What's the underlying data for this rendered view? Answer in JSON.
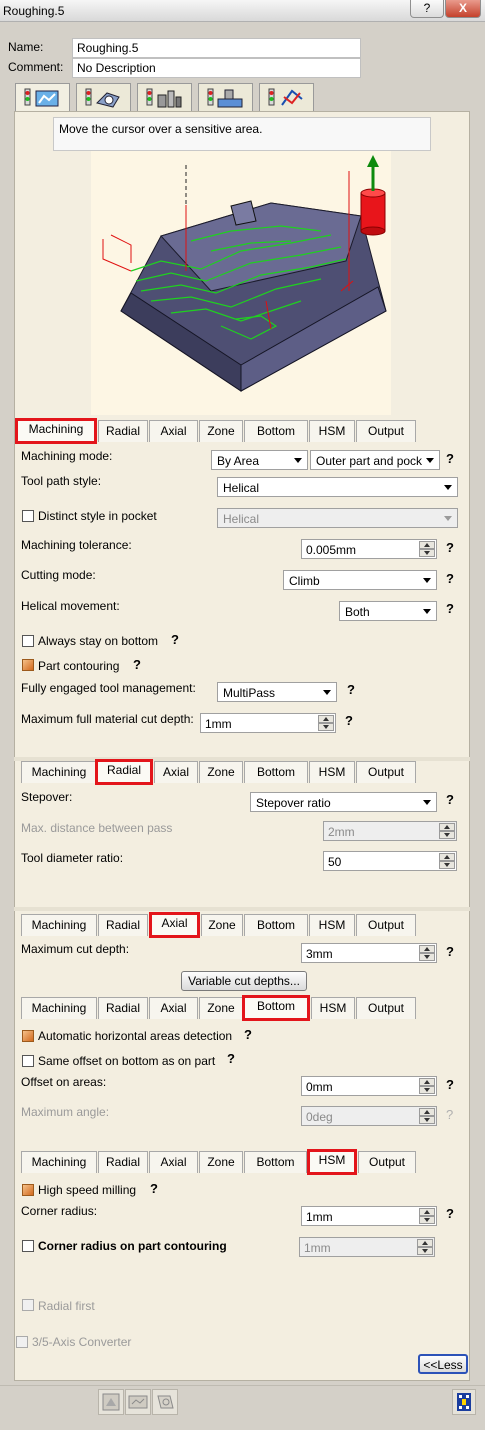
{
  "window": {
    "title": "Roughing.5",
    "help_btn": "?",
    "close_btn": "X"
  },
  "header": {
    "name_label": "Name:",
    "name_value": "Roughing.5",
    "comment_label": "Comment:",
    "comment_value": "No Description"
  },
  "icon_tabs": [
    "strategy-icon",
    "geometry-icon",
    "tool-icon",
    "feeds-speeds-icon",
    "macros-icon"
  ],
  "info": {
    "message": "Move the cursor over a sensitive area."
  },
  "tabs": [
    "Machining",
    "Radial",
    "Axial",
    "Zone",
    "Bottom",
    "HSM",
    "Output"
  ],
  "machining": {
    "mode_label": "Machining mode:",
    "mode_value": "By Area",
    "mode_value2": "Outer part and pock",
    "toolpath_label": "Tool path style:",
    "toolpath_value": "Helical",
    "distinct_label": "Distinct style in pocket",
    "distinct_value": "Helical",
    "tolerance_label": "Machining tolerance:",
    "tolerance_value": "0.005mm",
    "cutting_label": "Cutting mode:",
    "cutting_value": "Climb",
    "helical_label": "Helical movement:",
    "helical_value": "Both",
    "always_bottom_label": "Always stay on bottom",
    "part_contouring_label": "Part contouring",
    "engaged_label": "Fully engaged tool management:",
    "engaged_value": "MultiPass",
    "max_cut_label": "Maximum full material cut depth:",
    "max_cut_value": "1mm"
  },
  "radial": {
    "stepover_label": "Stepover:",
    "stepover_value": "Stepover ratio",
    "maxdist_label": "Max. distance between pass",
    "maxdist_value": "2mm",
    "diam_label": "Tool diameter ratio:",
    "diam_value": "50"
  },
  "axial": {
    "maxcut_label": "Maximum cut depth:",
    "maxcut_value": "3mm",
    "variable_button": "Variable cut depths..."
  },
  "bottom": {
    "auto_label": "Automatic horizontal areas detection",
    "same_offset_label": "Same offset on bottom as on part",
    "offset_label": "Offset on areas:",
    "offset_value": "0mm",
    "angle_label": "Maximum angle:",
    "angle_value": "0deg"
  },
  "hsm": {
    "hsm_label": "High speed milling",
    "corner_label": "Corner radius:",
    "corner_value": "1mm",
    "corner_contour_label": "Corner radius on part contouring",
    "corner_contour_value": "1mm",
    "radial_first_label": "Radial first"
  },
  "footer": {
    "converter_label": "3/5-Axis Converter",
    "less_button": "<<Less"
  },
  "question_mark": "?",
  "colors": {
    "tab_highlight": "#e3151b",
    "panel_bg": "#f3eee0",
    "toolpath_green": "#1fd11f",
    "toolpath_red": "#e01010"
  }
}
